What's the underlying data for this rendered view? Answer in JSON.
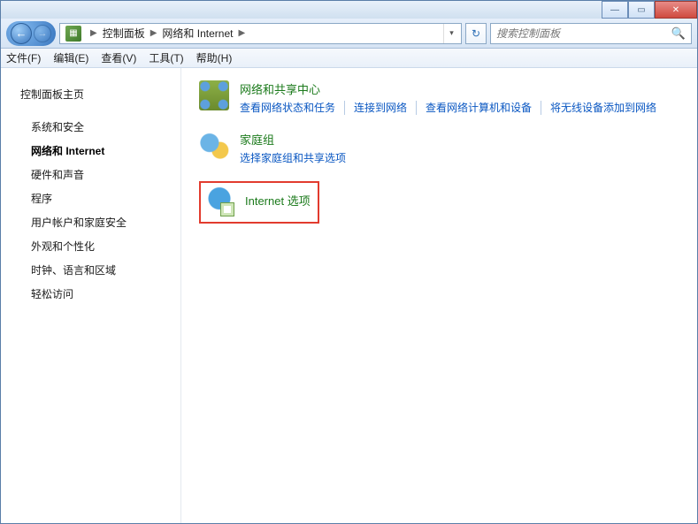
{
  "titlebar": {
    "min": "—",
    "max": "▭",
    "close": "✕"
  },
  "breadcrumb": {
    "root_icon": "▦",
    "seg1": "控制面板",
    "seg2": "网络和 Internet",
    "dropdown": "▾"
  },
  "refresh": "↻",
  "search": {
    "placeholder": "搜索控制面板",
    "icon": "🔍"
  },
  "menu": {
    "file": "文件(F)",
    "edit": "编辑(E)",
    "view": "查看(V)",
    "tools": "工具(T)",
    "help": "帮助(H)"
  },
  "sidebar": {
    "home": "控制面板主页",
    "items": [
      "系统和安全",
      "网络和 Internet",
      "硬件和声音",
      "程序",
      "用户帐户和家庭安全",
      "外观和个性化",
      "时钟、语言和区域",
      "轻松访问"
    ]
  },
  "content": {
    "network": {
      "title": "网络和共享中心",
      "links": [
        "查看网络状态和任务",
        "连接到网络",
        "查看网络计算机和设备",
        "将无线设备添加到网络"
      ]
    },
    "homegroup": {
      "title": "家庭组",
      "links": [
        "选择家庭组和共享选项"
      ]
    },
    "internet": {
      "title": "Internet 选项"
    }
  }
}
